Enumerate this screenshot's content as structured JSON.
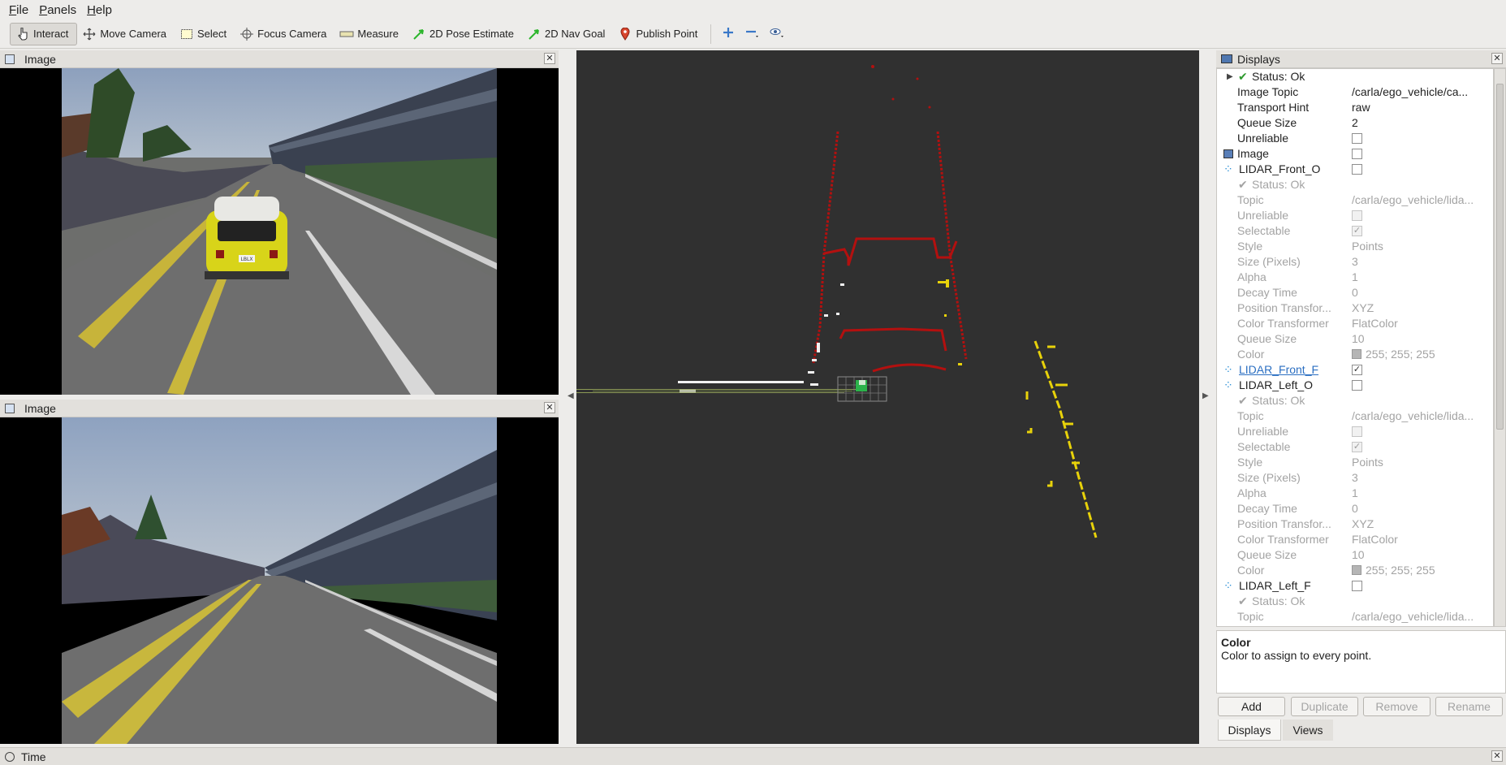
{
  "menu": [
    {
      "key": "F",
      "rest": "ile"
    },
    {
      "key": "P",
      "rest": "anels"
    },
    {
      "key": "H",
      "rest": "elp"
    }
  ],
  "toolbar": {
    "interact": "Interact",
    "move_camera": "Move Camera",
    "select": "Select",
    "focus_camera": "Focus Camera",
    "measure": "Measure",
    "pose_estimate": "2D Pose Estimate",
    "nav_goal": "2D Nav Goal",
    "publish_point": "Publish Point"
  },
  "image_panels": [
    {
      "title": "Image",
      "badge": "LBLX"
    },
    {
      "title": "Image"
    }
  ],
  "displays": {
    "title": "Displays",
    "rows": [
      {
        "label": "Status: Ok",
        "value": ""
      },
      {
        "label": "Image Topic",
        "value": "/carla/ego_vehicle/ca..."
      },
      {
        "label": "Transport Hint",
        "value": "raw"
      },
      {
        "label": "Queue Size",
        "value": "2"
      },
      {
        "label": "Unreliable",
        "value": ""
      },
      {
        "label": "Image",
        "value": ""
      },
      {
        "label": "LIDAR_Front_O",
        "value": ""
      },
      {
        "label": "Status: Ok",
        "value": ""
      },
      {
        "label": "Topic",
        "value": "/carla/ego_vehicle/lida..."
      },
      {
        "label": "Unreliable",
        "value": ""
      },
      {
        "label": "Selectable",
        "value": ""
      },
      {
        "label": "Style",
        "value": "Points"
      },
      {
        "label": "Size (Pixels)",
        "value": "3"
      },
      {
        "label": "Alpha",
        "value": "1"
      },
      {
        "label": "Decay Time",
        "value": "0"
      },
      {
        "label": "Position Transfor...",
        "value": "XYZ"
      },
      {
        "label": "Color Transformer",
        "value": "FlatColor"
      },
      {
        "label": "Queue Size",
        "value": "10"
      },
      {
        "label": "Color",
        "value": "255; 255; 255"
      },
      {
        "label": "LIDAR_Front_F",
        "value": ""
      },
      {
        "label": "LIDAR_Left_O",
        "value": ""
      },
      {
        "label": "Status: Ok",
        "value": ""
      },
      {
        "label": "Topic",
        "value": "/carla/ego_vehicle/lida..."
      },
      {
        "label": "Unreliable",
        "value": ""
      },
      {
        "label": "Selectable",
        "value": ""
      },
      {
        "label": "Style",
        "value": "Points"
      },
      {
        "label": "Size (Pixels)",
        "value": "3"
      },
      {
        "label": "Alpha",
        "value": "1"
      },
      {
        "label": "Decay Time",
        "value": "0"
      },
      {
        "label": "Position Transfor...",
        "value": "XYZ"
      },
      {
        "label": "Color Transformer",
        "value": "FlatColor"
      },
      {
        "label": "Queue Size",
        "value": "10"
      },
      {
        "label": "Color",
        "value": "255; 255; 255"
      },
      {
        "label": "LIDAR_Left_F",
        "value": ""
      },
      {
        "label": "Status: Ok",
        "value": ""
      },
      {
        "label": "Topic",
        "value": "/carla/ego_vehicle/lida..."
      }
    ],
    "desc_title": "Color",
    "desc_text": "Color to assign to every point.",
    "buttons": {
      "add": "Add",
      "duplicate": "Duplicate",
      "remove": "Remove",
      "rename": "Rename"
    },
    "tabs": {
      "displays": "Displays",
      "views": "Views"
    }
  },
  "time_panel": {
    "title": "Time"
  },
  "colors": {
    "accent": "#2b6fc2",
    "lidar_red": "#b3100f",
    "lidar_yellow": "#e8d20a",
    "viewport_bg": "#303030"
  }
}
